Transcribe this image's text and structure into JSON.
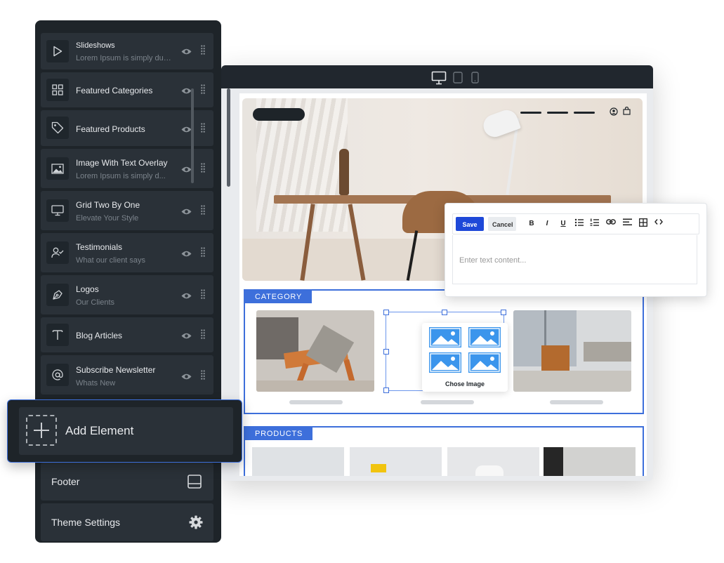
{
  "sidebar": {
    "items": [
      {
        "title": "Slideshows",
        "subtitle": "Lorem Ipsum is simply dum..."
      },
      {
        "title": "Featured Categories",
        "subtitle": ""
      },
      {
        "title": "Featured Products",
        "subtitle": ""
      },
      {
        "title": "Image With Text Overlay",
        "subtitle": "Lorem Ipsum is simply d..."
      },
      {
        "title": "Grid Two By One",
        "subtitle": "Elevate Your Style"
      },
      {
        "title": "Testimonials",
        "subtitle": "What our client says"
      },
      {
        "title": "Logos",
        "subtitle": "Our Clients"
      },
      {
        "title": "Blog Articles",
        "subtitle": ""
      },
      {
        "title": "Subscribe Newsletter",
        "subtitle": "Whats New"
      }
    ],
    "add_element_label": "Add Element",
    "footer_label": "Footer",
    "theme_settings_label": "Theme Settings"
  },
  "preview": {
    "category_tag": "CATEGORY",
    "products_tag": "PRODUCTS",
    "chose_image_label": "Chose Image"
  },
  "editor": {
    "save_label": "Save",
    "cancel_label": "Cancel",
    "placeholder": "Enter text content...",
    "toolbar": [
      "B",
      "I",
      "U"
    ]
  },
  "colors": {
    "accent": "#3d6fdb",
    "save_button": "#1e48d8",
    "sidebar_bg": "#1e2429",
    "item_bg": "#2a3138",
    "image_placeholder": "#3b95ec"
  }
}
